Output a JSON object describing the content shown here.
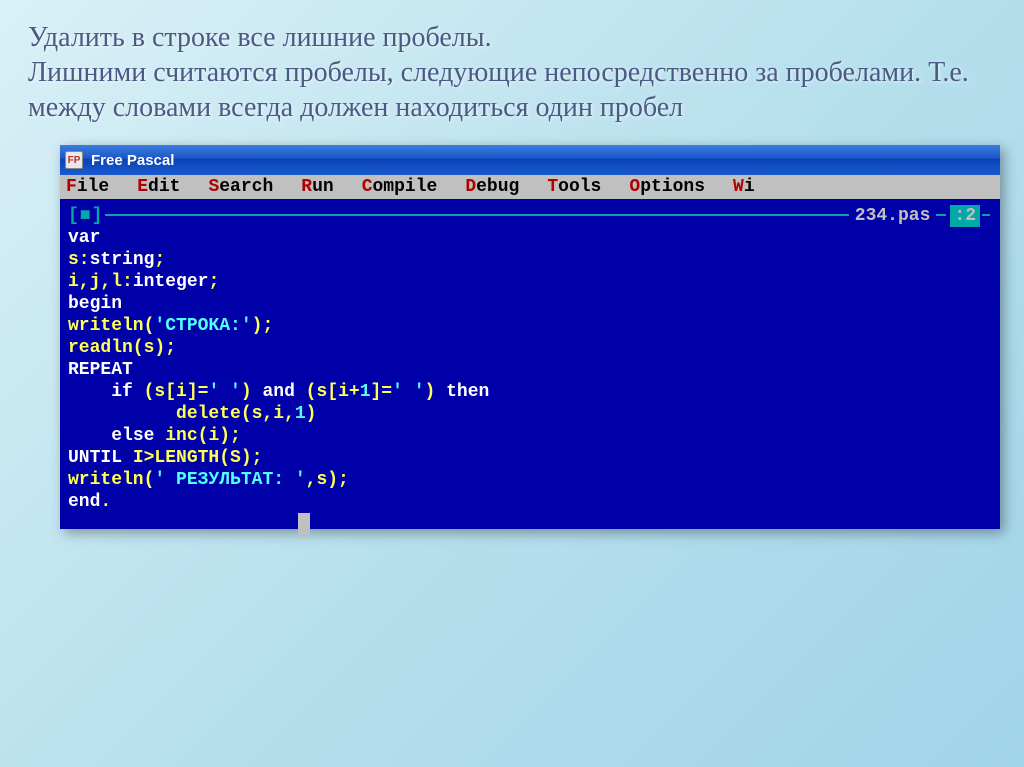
{
  "slide": {
    "title": "Удалить в строке все лишние пробелы.\nЛишними считаются пробелы, следующие непосредственно за пробелами. Т.е. между словами всегда должен находиться один пробел"
  },
  "titlebar": {
    "icon_label": "FP",
    "text": "Free Pascal"
  },
  "menu": {
    "items": [
      "File",
      "Edit",
      "Search",
      "Run",
      "Compile",
      "Debug",
      "Tools",
      "Options",
      "Wi"
    ]
  },
  "editor": {
    "filename": "234.pas",
    "top_ctrls": "[■]",
    "title_suffix": ":2",
    "lines": [
      {
        "parts": [
          {
            "t": "var",
            "c": "kw"
          }
        ]
      },
      {
        "parts": [
          {
            "t": "s:",
            "c": "norm"
          },
          {
            "t": "string",
            "c": "kw"
          },
          {
            "t": ";",
            "c": "norm"
          }
        ]
      },
      {
        "parts": [
          {
            "t": "i,j,l:",
            "c": "norm"
          },
          {
            "t": "integer",
            "c": "kw"
          },
          {
            "t": ";",
            "c": "norm"
          }
        ]
      },
      {
        "parts": [
          {
            "t": "begin",
            "c": "kw"
          }
        ]
      },
      {
        "parts": [
          {
            "t": "writeln(",
            "c": "norm"
          },
          {
            "t": "'СТРОКА:'",
            "c": "str"
          },
          {
            "t": ");",
            "c": "norm"
          }
        ]
      },
      {
        "parts": [
          {
            "t": "readln(s);",
            "c": "norm"
          }
        ]
      },
      {
        "parts": [
          {
            "t": "REPEAT",
            "c": "kw"
          }
        ]
      },
      {
        "parts": [
          {
            "t": "    ",
            "c": "norm"
          },
          {
            "t": "if",
            "c": "kw"
          },
          {
            "t": " (s[i]=",
            "c": "norm"
          },
          {
            "t": "' '",
            "c": "str"
          },
          {
            "t": ") ",
            "c": "norm"
          },
          {
            "t": "and",
            "c": "kw"
          },
          {
            "t": " (s[i+",
            "c": "norm"
          },
          {
            "t": "1",
            "c": "num"
          },
          {
            "t": "]=",
            "c": "norm"
          },
          {
            "t": "' '",
            "c": "str"
          },
          {
            "t": ") ",
            "c": "norm"
          },
          {
            "t": "then",
            "c": "kw"
          }
        ]
      },
      {
        "parts": [
          {
            "t": "          delete(s,i,",
            "c": "norm"
          },
          {
            "t": "1",
            "c": "num"
          },
          {
            "t": ")",
            "c": "norm"
          }
        ]
      },
      {
        "parts": [
          {
            "t": "    ",
            "c": "norm"
          },
          {
            "t": "else",
            "c": "kw"
          },
          {
            "t": " inc(i);",
            "c": "norm"
          }
        ]
      },
      {
        "parts": [
          {
            "t": "UNTIL",
            "c": "kw"
          },
          {
            "t": " I>LENGTH(S);",
            "c": "norm"
          }
        ]
      },
      {
        "parts": [
          {
            "t": "writeln(",
            "c": "norm"
          },
          {
            "t": "' РЕЗУЛЬТАТ: '",
            "c": "str"
          },
          {
            "t": ",s);",
            "c": "norm"
          }
        ]
      },
      {
        "parts": [
          {
            "t": "end",
            "c": "kw"
          },
          {
            "t": ".",
            "c": "norm"
          }
        ]
      }
    ]
  }
}
